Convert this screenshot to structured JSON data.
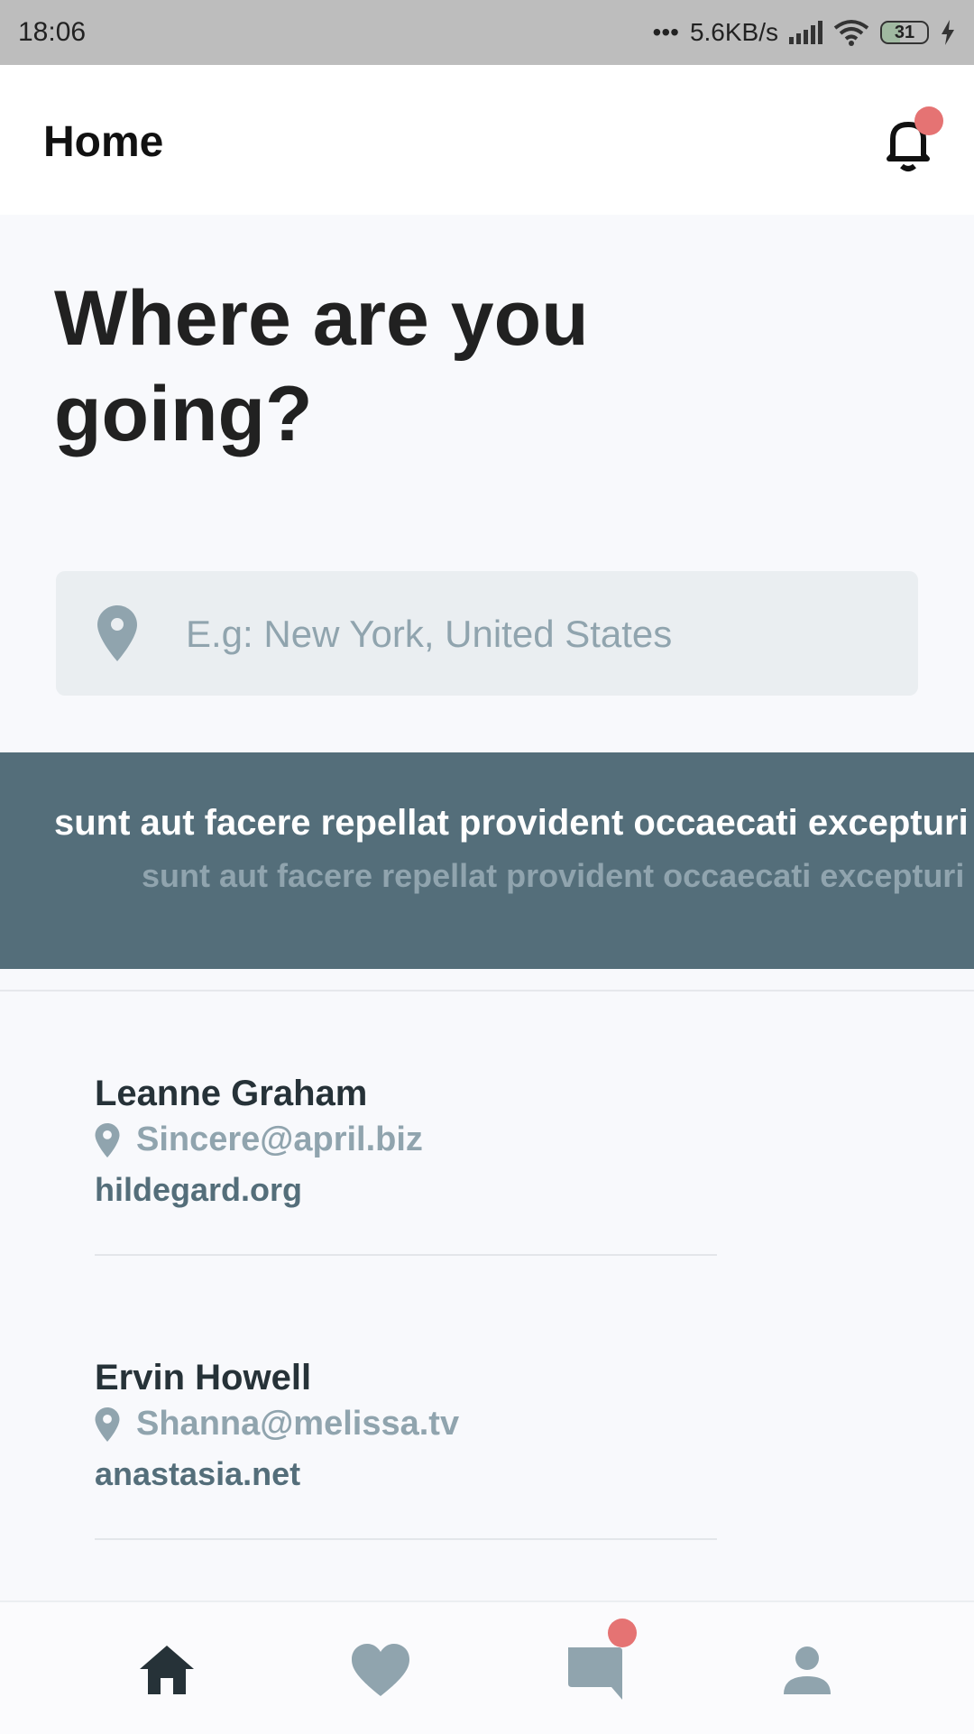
{
  "status_bar": {
    "time": "18:06",
    "network_speed": "5.6KB/s",
    "battery_level": "31"
  },
  "header": {
    "title": "Home",
    "notification_icon": "bell-icon"
  },
  "hero": {
    "headline_line1": "Where are you",
    "headline_line2": "going?"
  },
  "search": {
    "placeholder": "E.g: New York, United States",
    "value": "",
    "icon": "location-pin-icon"
  },
  "banner": {
    "title": "sunt aut facere repellat provident occaecati excepturi optio reprehenderit",
    "subtitle": "sunt aut facere repellat provident occaecati excepturi optio reprehenderit"
  },
  "list": [
    {
      "name": "Leanne Graham",
      "email": "Sincere@april.biz",
      "website": "hildegard.org"
    },
    {
      "name": "Ervin Howell",
      "email": "Shanna@melissa.tv",
      "website": "anastasia.net"
    }
  ],
  "bottom_nav": {
    "items": [
      "home-icon",
      "heart-icon",
      "chat-icon",
      "person-icon"
    ],
    "active": "home-icon"
  },
  "colors": {
    "accent": "#546e7a",
    "badge": "#e57373",
    "muted": "#90a4ae",
    "active_nav": "#263238"
  }
}
